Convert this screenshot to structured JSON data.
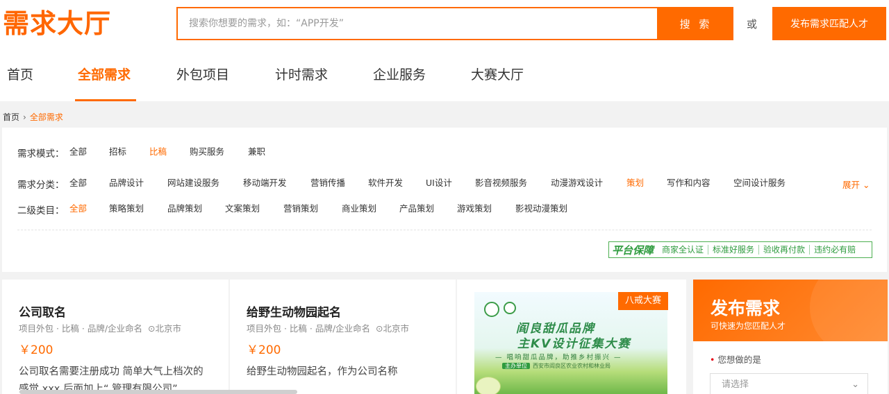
{
  "header": {
    "logo": "需求大厅",
    "search_placeholder": "搜索你想要的需求，如：“APP开发”",
    "search_button": "搜 索",
    "or": "或",
    "publish_button": "发布需求匹配人才"
  },
  "nav": {
    "items": [
      "首页",
      "全部需求",
      "外包项目",
      "计时需求",
      "企业服务",
      "大赛大厅"
    ],
    "active": "全部需求"
  },
  "breadcrumb": {
    "home": "首页",
    "sep": "›",
    "current": "全部需求"
  },
  "filters": {
    "mode": {
      "label": "需求模式：",
      "options": [
        "全部",
        "招标",
        "比稿",
        "购买服务",
        "兼职"
      ],
      "selected": "比稿"
    },
    "category": {
      "label": "需求分类：",
      "options": [
        "全部",
        "品牌设计",
        "网站建设服务",
        "移动端开发",
        "营销传播",
        "软件开发",
        "UI设计",
        "影音视频服务",
        "动漫游戏设计",
        "策划",
        "写作和内容",
        "空间设计服务"
      ],
      "selected": "策划"
    },
    "expand": "展开 ⌄",
    "subcategory": {
      "label": "二级类目：",
      "options": [
        "全部",
        "策略策划",
        "品牌策划",
        "文案策划",
        "营销策划",
        "商业策划",
        "产品策划",
        "游戏策划",
        "影视动漫策划"
      ],
      "selected": "全部"
    }
  },
  "guarantee": {
    "badge": "平台保障",
    "items": [
      "商家全认证",
      "标准好服务",
      "验收再付款",
      "违约必有赔"
    ]
  },
  "cards": [
    {
      "title": "公司取名",
      "meta": "项目外包 · 比稿 · 品牌/企业命名",
      "location": "北京市",
      "price": "￥200",
      "desc": "公司取名需要注册成功 简单大气上档次的感觉 xxx 后面加上“ 管理有限公司”"
    },
    {
      "title": "给野生动物园起名",
      "meta": "项目外包 · 比稿 · 品牌/企业命名",
      "location": "北京市",
      "price": "￥200",
      "desc": "给野生动物园起名，作为公司名称"
    }
  ],
  "contest": {
    "tag": "八戒大赛",
    "line1": "阎良甜瓜品牌",
    "line2": "主KV设计征集大赛",
    "line3": "— 唱响甜瓜品牌，助推乡村振兴 —",
    "host_tag": "主办单位",
    "host": "西安市阎良区农业农村和林业局"
  },
  "side": {
    "title": "发布需求",
    "subtitle": "可快速为您匹配人才",
    "label": "您想做的是",
    "select_placeholder": "请选择"
  }
}
